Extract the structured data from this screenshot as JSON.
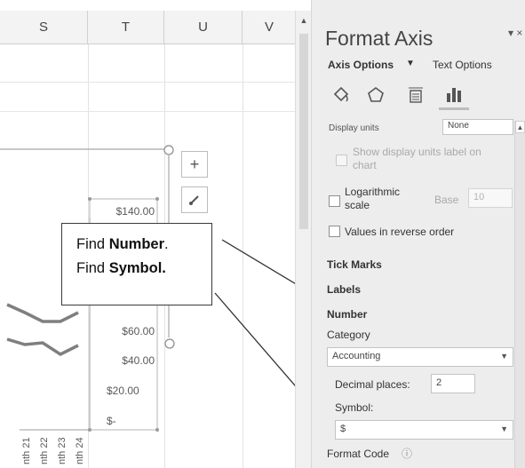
{
  "sheet": {
    "columns": [
      "S",
      "T",
      "U",
      "V"
    ],
    "y_axis_labels": [
      "$140.00",
      "$60.00",
      "$40.00",
      "$20.00",
      "$-"
    ],
    "x_axis_labels": [
      "nth 21",
      "nth 22",
      "nth 23",
      "nth 24"
    ],
    "chart_buttons": {
      "add_element": "+",
      "style": "🖌"
    }
  },
  "callout": {
    "line1_prefix": "Find ",
    "line1_bold": "Number",
    "line1_suffix": ".",
    "line2_prefix": "Find ",
    "line2_bold": "Symbol."
  },
  "pane": {
    "title": "Format Axis",
    "close": "▾ ×",
    "tabs": {
      "axis_options": "Axis Options",
      "text_options": "Text Options"
    },
    "icons": [
      "fill-line-icon",
      "effects-icon",
      "size-properties-icon",
      "axis-options-icon"
    ],
    "display_units": {
      "label": "Display units",
      "value": "None"
    },
    "show_units_label": "Show display units label on chart",
    "logarithmic": {
      "label": "Logarithmic scale",
      "base_label": "Base",
      "base_value": "10"
    },
    "values_reverse": "Values in reverse order",
    "tick_marks": "Tick Marks",
    "labels": "Labels",
    "number": {
      "heading": "Number",
      "category_label": "Category",
      "category_value": "Accounting",
      "decimal_label": "Decimal places:",
      "decimal_value": "2",
      "symbol_label": "Symbol:",
      "symbol_value": "$",
      "format_code_label": "Format Code",
      "info_glyph": "ⓘ"
    }
  },
  "colors": {
    "pane_bg": "#ededed",
    "series_line": "#7f7f7f",
    "callout_border": "#3a3a3a"
  }
}
